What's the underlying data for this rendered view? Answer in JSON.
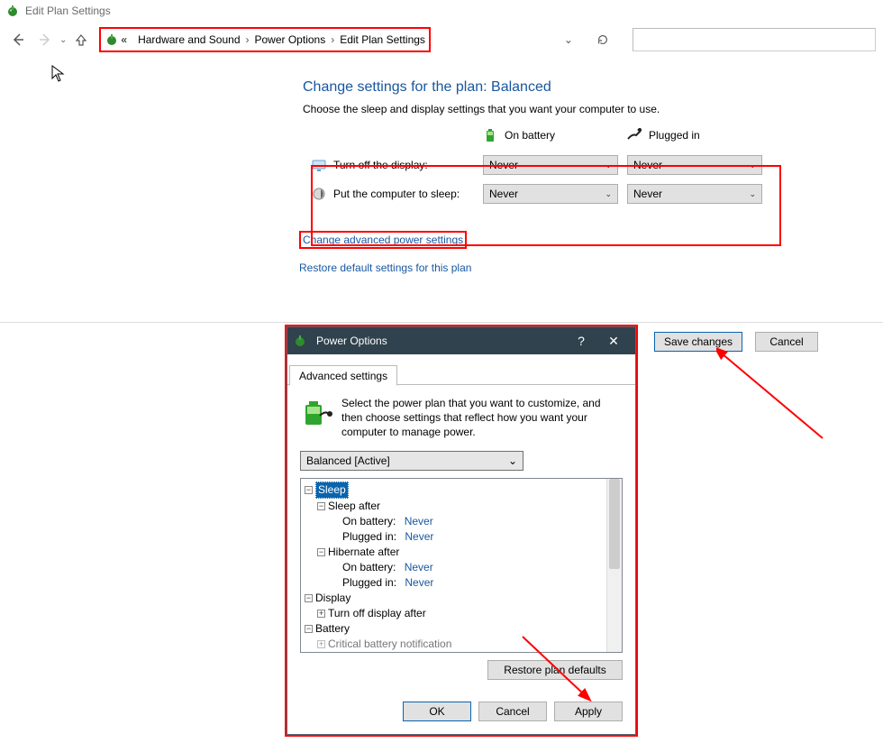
{
  "window": {
    "title": "Edit Plan Settings"
  },
  "breadcrumb": {
    "prefix": "«",
    "items": [
      "Hardware and Sound",
      "Power Options",
      "Edit Plan Settings"
    ]
  },
  "page": {
    "heading": "Change settings for the plan: Balanced",
    "subtext": "Choose the sleep and display settings that you want your computer to use.",
    "columns": {
      "battery": "On battery",
      "plugged": "Plugged in"
    },
    "rows": {
      "display_label": "Turn off the display:",
      "sleep_label": "Put the computer to sleep:",
      "display_battery": "Never",
      "display_plugged": "Never",
      "sleep_battery": "Never",
      "sleep_plugged": "Never"
    },
    "link_advanced": "Change advanced power settings",
    "link_restore": "Restore default settings for this plan",
    "save_button": "Save changes",
    "cancel_button": "Cancel"
  },
  "dialog": {
    "title": "Power Options",
    "tab": "Advanced settings",
    "description": "Select the power plan that you want to customize, and then choose settings that reflect how you want your computer to manage power.",
    "plan_select": "Balanced [Active]",
    "tree": {
      "sleep": "Sleep",
      "sleep_after": "Sleep after",
      "on_battery_label": "On battery:",
      "plugged_in_label": "Plugged in:",
      "never": "Never",
      "hibernate_after": "Hibernate after",
      "display": "Display",
      "turn_off_display_after": "Turn off display after",
      "battery": "Battery",
      "critical_battery_notification": "Critical battery notification"
    },
    "restore_defaults": "Restore plan defaults",
    "ok": "OK",
    "cancel": "Cancel",
    "apply": "Apply"
  }
}
